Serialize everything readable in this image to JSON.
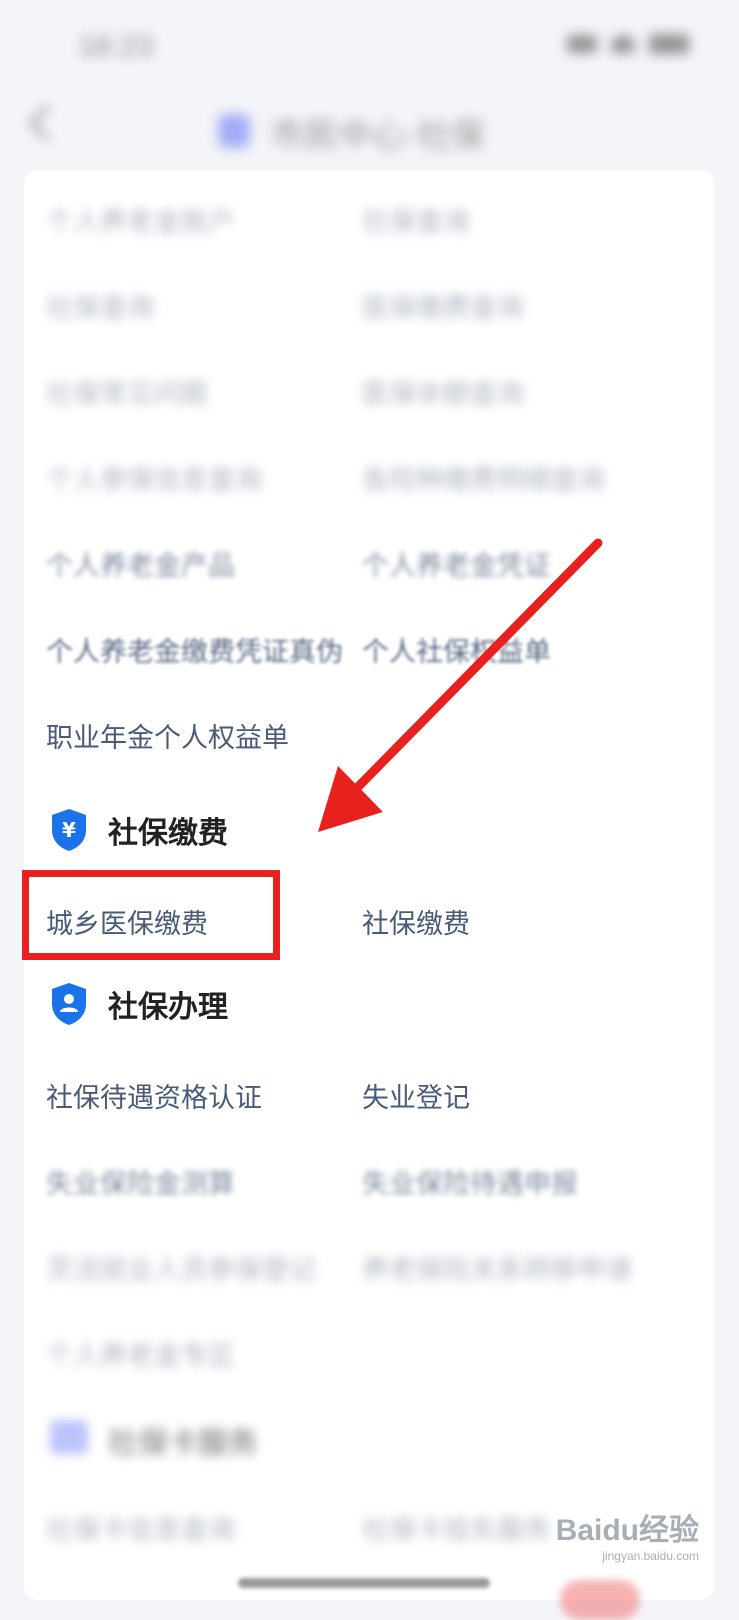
{
  "status_bar": {
    "time": "16:23"
  },
  "nav": {
    "title": "市民中心·社保"
  },
  "top_items": [
    {
      "left": "个人养老金账户",
      "right": "社保查询"
    },
    {
      "left": "社保查询",
      "right": "医保缴费查询"
    },
    {
      "left": "社保常见问题",
      "right": "医保余额查询"
    },
    {
      "left": "个人参保信息查询",
      "right": "各险种缴费明细查询"
    },
    {
      "left": "个人养老金产品",
      "right": "个人养老金凭证"
    },
    {
      "left": "个人养老金缴费凭证真伪",
      "right": "个人社保权益单"
    },
    {
      "left": "职业年金个人权益单",
      "right": ""
    }
  ],
  "section_pay": {
    "title": "社保缴费",
    "items": [
      "城乡医保缴费",
      "社保缴费"
    ]
  },
  "section_handle": {
    "title": "社保办理",
    "items": [
      {
        "left": "社保待遇资格认证",
        "right": "失业登记"
      },
      {
        "left": "失业保险金测算",
        "right": "失业保险待遇申报"
      },
      {
        "left": "灵活就业人员参保登记",
        "right": "养老保险关系转移申请"
      },
      {
        "left": "个人养老金专区",
        "right": ""
      }
    ]
  },
  "section_card": {
    "title": "社保卡服务",
    "items": [
      {
        "left": "社保卡信息查询",
        "right": "社保卡挂失服务"
      }
    ]
  },
  "watermark": {
    "brand": "Baidu经验",
    "url": "jingyan.baidu.com"
  },
  "colors": {
    "accent": "#1a73e8",
    "highlight": "#e8201e",
    "item_text": "#4a5a78"
  }
}
